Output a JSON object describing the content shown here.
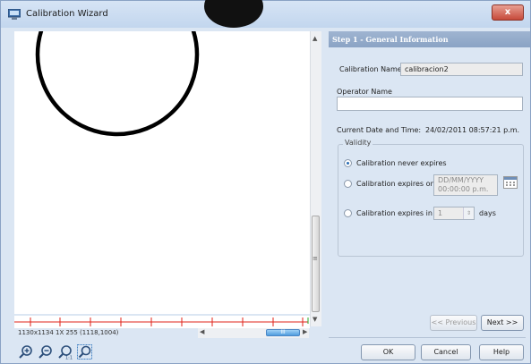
{
  "window": {
    "title": "Calibration Wizard",
    "close_label": "x"
  },
  "viewer": {
    "status": "1130x1134 1X 255   (1118,1004)",
    "hscroll_grip": "III",
    "vscroll_grip": "≡"
  },
  "zoom_tools": [
    "zoom-in-icon",
    "zoom-out-icon",
    "zoom-actual-size-icon",
    "zoom-fit-icon"
  ],
  "panel": {
    "step_title": "Step 1 - General Information",
    "calibration_name_label": "Calibration Name",
    "calibration_name_value": "calibracion2",
    "operator_name_label": "Operator Name",
    "operator_name_value": "",
    "datetime_label": "Current Date and Time:",
    "datetime_value": "24/02/2011  08:57:21 p.m.",
    "validity_title": "Validity",
    "options": {
      "never": "Calibration never expires",
      "expires_on": "Calibration expires on",
      "expires_in": "Calibration expires in"
    },
    "date_placeholder_line1": "DD/MM/YYYY",
    "date_placeholder_line2": "00:00:00 p.m.",
    "days_value": "1",
    "days_label": "days",
    "selected_option": "never"
  },
  "nav": {
    "previous": "<< Previous",
    "next": "Next >>"
  },
  "footer": {
    "ok": "OK",
    "cancel": "Cancel",
    "help": "Help"
  },
  "colors": {
    "accent": "#9fb4d1",
    "panel_bg": "#dbe6f3",
    "ruler": "#e0231a"
  }
}
